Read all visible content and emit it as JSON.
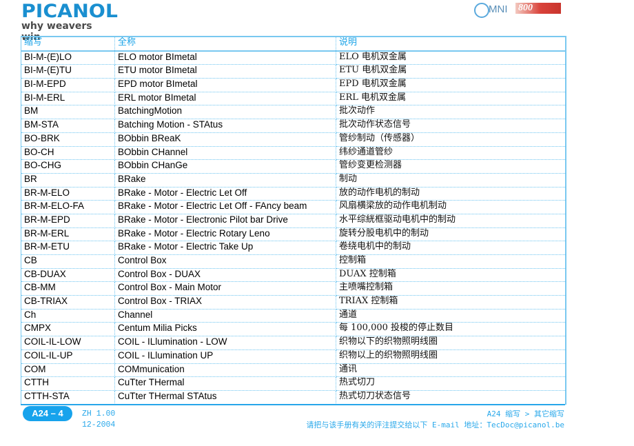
{
  "header": {
    "brand_logo_text": "PICANOL",
    "brand_tagline": "why weavers win",
    "product_logo": {
      "prefix": "MNI",
      "model": "800"
    }
  },
  "table": {
    "columns": [
      "缩写",
      "全称",
      "说明"
    ],
    "rows": [
      {
        "abbr": "BI-M-(E)LO",
        "full": "ELO motor BImetal",
        "desc": "ELO 电机双金属"
      },
      {
        "abbr": "BI-M-(E)TU",
        "full": "ETU motor BImetal",
        "desc": "ETU 电机双金属"
      },
      {
        "abbr": "BI-M-EPD",
        "full": "EPD motor BImetal",
        "desc": "EPD 电机双金属"
      },
      {
        "abbr": "BI-M-ERL",
        "full": "ERL motor BImetal",
        "desc": "ERL 电机双金属"
      },
      {
        "abbr": "BM",
        "full": "BatchingMotion",
        "desc": "批次动作"
      },
      {
        "abbr": "BM-STA",
        "full": "Batching Motion - STAtus",
        "desc": "批次动作状态信号"
      },
      {
        "abbr": "BO-BRK",
        "full": "BObbin BReaK",
        "desc": "管纱制动（传感器）"
      },
      {
        "abbr": "BO-CH",
        "full": "BObbin CHannel",
        "desc": "纬纱通道管纱"
      },
      {
        "abbr": "BO-CHG",
        "full": "BObbin CHanGe",
        "desc": "管纱变更检测器"
      },
      {
        "abbr": "BR",
        "full": "BRake",
        "desc": "制动"
      },
      {
        "abbr": "BR-M-ELO",
        "full": "BRake - Motor - Electric Let Off",
        "desc": "放的动作电机的制动"
      },
      {
        "abbr": "BR-M-ELO-FA",
        "full": "BRake - Motor - Electric Let Off - FAncy beam",
        "desc": "风扇横梁放的动作电机制动"
      },
      {
        "abbr": "BR-M-EPD",
        "full": "BRake - Motor - Electronic Pilot bar Drive",
        "desc": "水平综絖框驱动电机中的制动"
      },
      {
        "abbr": "BR-M-ERL",
        "full": "BRake - Motor - Electric Rotary Leno",
        "desc": "旋转分股电机中的制动"
      },
      {
        "abbr": "BR-M-ETU",
        "full": "BRake - Motor - Electric Take Up",
        "desc": "卷绕电机中的制动"
      },
      {
        "abbr": "CB",
        "full": "Control Box",
        "desc": "控制箱"
      },
      {
        "abbr": "CB-DUAX",
        "full": "Control Box - DUAX",
        "desc": "DUAX 控制箱"
      },
      {
        "abbr": "CB-MM",
        "full": "Control Box - Main Motor",
        "desc": "主喷嘴控制箱"
      },
      {
        "abbr": "CB-TRIAX",
        "full": "Control Box - TRIAX",
        "desc": "TRIAX 控制箱"
      },
      {
        "abbr": "Ch",
        "full": "Channel",
        "desc": "通道"
      },
      {
        "abbr": "CMPX",
        "full": "Centum Milia Picks",
        "desc": "每 100,000 投梭的停止数目"
      },
      {
        "abbr": "COIL-IL-LOW",
        "full": "COIL - ILlumination - LOW",
        "desc": "织物以下的织物照明线圈"
      },
      {
        "abbr": "COIL-IL-UP",
        "full": "COIL - ILlumination UP",
        "desc": "织物以上的织物照明线圈"
      },
      {
        "abbr": "COM",
        "full": "COMmunication",
        "desc": "通讯"
      },
      {
        "abbr": "CTTH",
        "full": "CuTter THermal",
        "desc": "热式切刀"
      },
      {
        "abbr": "CTTH-STA",
        "full": "CuTter THermal STAtus",
        "desc": "热式切刀状态信号"
      }
    ]
  },
  "footer": {
    "page_label": "A24 – 4",
    "version": "ZH 1.00",
    "date": "12-2004",
    "breadcrumb": "A24 缩写 > 其它缩写",
    "feedback_note": "请把与该手册有关的评注提交给以下 E-mail 地址：TecDoc@picanol.be"
  },
  "colors": {
    "accent": "#1aa3e8",
    "brand_blue": "#1a8fd0",
    "border": "#79c8f0"
  }
}
